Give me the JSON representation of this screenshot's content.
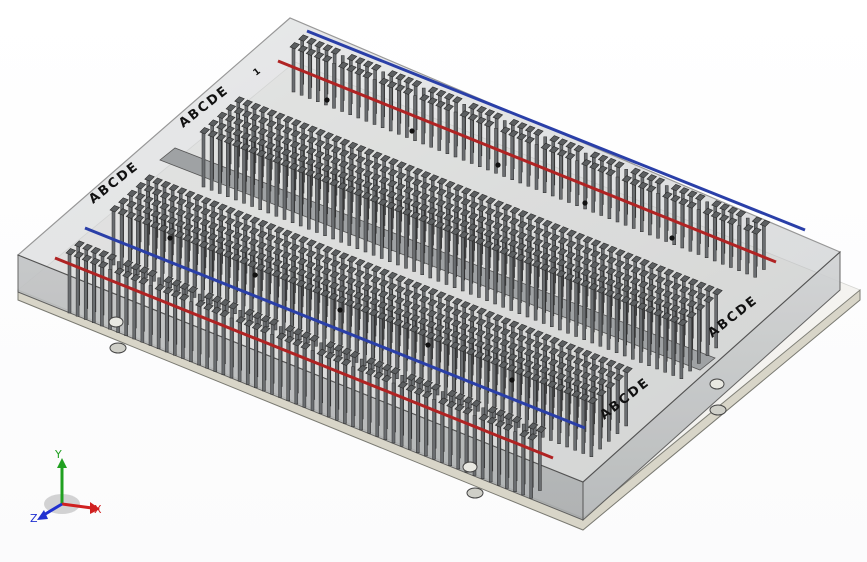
{
  "model": {
    "row_labels": [
      "ABCDE",
      "ABCDE",
      "ABCDE",
      "ABCDE"
    ],
    "column_marker": "1",
    "rail_colors": {
      "positive": "#b02323",
      "negative": "#2a3fa8"
    },
    "body_color": "#c9cbcc",
    "base_color": "#d8d5c8"
  },
  "triad": {
    "x_label": "X",
    "y_label": "Y",
    "z_label": "Z",
    "x_color": "#d02020",
    "y_color": "#20a020",
    "z_color": "#2030d0"
  }
}
